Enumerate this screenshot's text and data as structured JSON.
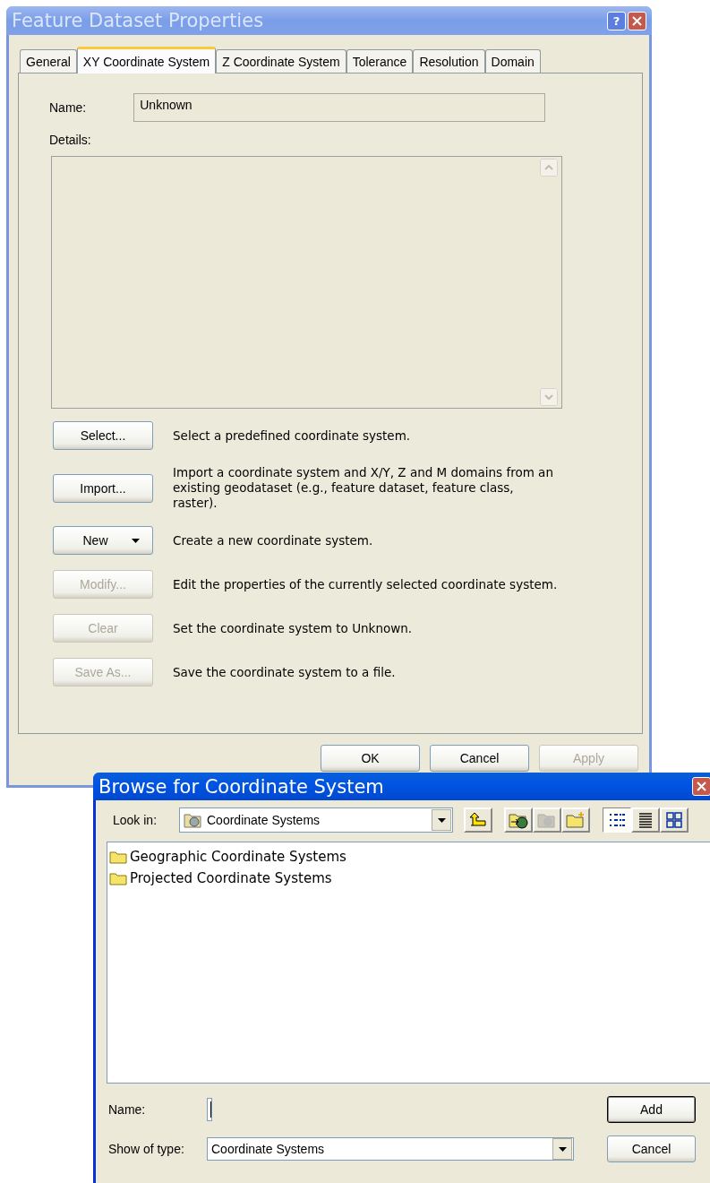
{
  "properties_dialog": {
    "title": "Feature Dataset Properties",
    "active": false,
    "help_glyph": "?",
    "tabs": [
      {
        "label": "General",
        "selected": false
      },
      {
        "label": "XY Coordinate System",
        "selected": true
      },
      {
        "label": "Z Coordinate System",
        "selected": false
      },
      {
        "label": "Tolerance",
        "selected": false
      },
      {
        "label": "Resolution",
        "selected": false
      },
      {
        "label": "Domain",
        "selected": false
      }
    ],
    "name_label": "Name:",
    "name_value": "Unknown",
    "details_label": "Details:",
    "actions": [
      {
        "kind": "plain",
        "button": "Select...",
        "disabled": false,
        "description": "Select a predefined coordinate system."
      },
      {
        "kind": "plain",
        "button": "Import...",
        "disabled": false,
        "description": "Import a coordinate system and X/Y, Z and M domains from an existing geodataset (e.g., feature dataset, feature class, raster)."
      },
      {
        "kind": "dropdown",
        "button": "New",
        "disabled": false,
        "description": "Create a new coordinate system."
      },
      {
        "kind": "plain",
        "button": "Modify...",
        "disabled": true,
        "description": "Edit the properties of the currently selected coordinate system."
      },
      {
        "kind": "plain",
        "button": "Clear",
        "disabled": true,
        "description": "Set the coordinate system to Unknown."
      },
      {
        "kind": "plain",
        "button": "Save As...",
        "disabled": true,
        "description": "Save the coordinate system to a file."
      }
    ],
    "footer_buttons": [
      {
        "label": "OK",
        "disabled": false
      },
      {
        "label": "Cancel",
        "disabled": false
      },
      {
        "label": "Apply",
        "disabled": true
      }
    ]
  },
  "browse_dialog": {
    "title": "Browse for Coordinate System",
    "active": true,
    "look_in_label": "Look in:",
    "look_in_value": "Coordinate Systems",
    "items": [
      {
        "name": "Geographic Coordinate Systems"
      },
      {
        "name": "Projected Coordinate Systems"
      }
    ],
    "name_label": "Name:",
    "show_type_label": "Show of type:",
    "show_type_value": "Coordinate Systems",
    "buttons": [
      {
        "label": "Add",
        "default": true
      },
      {
        "label": "Cancel",
        "default": false
      }
    ]
  }
}
